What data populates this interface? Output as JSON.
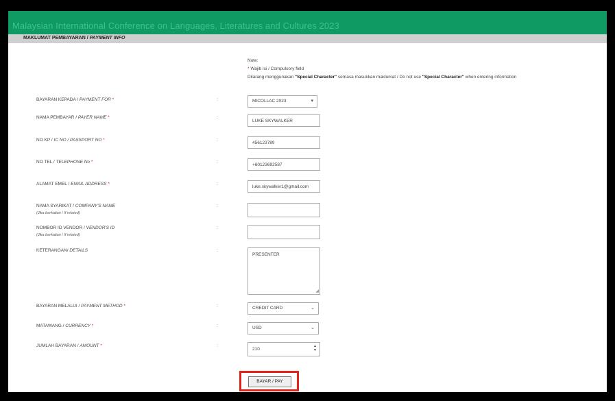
{
  "header": {
    "title": "Malaysian International Conference on Languages, Literatures and Cultures 2023",
    "section_title_ms": "MAKLUMAT PEMBAYARAN /",
    "section_title_en": "PAYMENT INFO"
  },
  "note": {
    "heading": "Note:",
    "line1_star": "*",
    "line1": " Wajib isi / Compulsory field",
    "line2_pre": "Dilarang menggunakan ",
    "special1": "\"Special Character\"",
    "line2_mid": " semasa masukkan maklumat / Do not use ",
    "special2": "\"Special Character\"",
    "line2_post": " when entering information"
  },
  "form": {
    "colon": ":",
    "required_mark": "*",
    "payment_for": {
      "label_ms": "BAYARAN KEPADA /",
      "label_en": "PAYMENT FOR",
      "value": "MICOLLAC 2023"
    },
    "payer_name": {
      "label_ms": "NAMA PEMBAYAR /",
      "label_en": "PAYER NAME",
      "value": "LUKE SKYWALKER"
    },
    "ic_no": {
      "label_ms": "NO KP /",
      "label_en": "IC NO / PASSPORT NO",
      "value": "456123789"
    },
    "telephone": {
      "label_ms": "NO TEL /",
      "label_en": "TELEPHONE No",
      "value": "+60123692587"
    },
    "email": {
      "label_ms": "ALAMAT EMEL /",
      "label_en": "EMAIL ADDRESS",
      "value": "luke.skywalker1@gmail.com"
    },
    "company": {
      "label_ms": "NAMA SYARIKAT /",
      "label_en": "COMPANY'S NAME",
      "sub": "(Jika berkaitan / If related)",
      "value": ""
    },
    "vendor_id": {
      "label_ms": "NOMBOR ID VENDOR /",
      "label_en": "VENDOR'S ID",
      "sub": "(Jika berkaitan / If related)",
      "value": ""
    },
    "details": {
      "label_ms": "KETERANGAN/",
      "label_en": "DETAILS",
      "value": "PRESENTER"
    },
    "payment_method": {
      "label_ms": "BAYARAN MELALUI /",
      "label_en": "PAYMENT METHOD",
      "value": "CREDIT CARD"
    },
    "currency": {
      "label_ms": "MATAWANG /",
      "label_en": "CURRENCY",
      "value": "USD"
    },
    "amount": {
      "label_ms": "JUMLAH BAYARAN /",
      "label_en": "AMOUNT",
      "value": "210"
    }
  },
  "pay_button": {
    "label": "BAYAR / PAY"
  },
  "icons": {
    "select_caret": "▾",
    "dropdown_chevron": "⌄",
    "resize_grip": "◢",
    "spinner_up": "▲",
    "spinner_down": "▼"
  },
  "colors": {
    "banner": "#0f9a63",
    "banner_text": "#3cc486",
    "subbar": "#cfcfcf",
    "required": "#e2231a",
    "highlight": "#e2231a"
  }
}
